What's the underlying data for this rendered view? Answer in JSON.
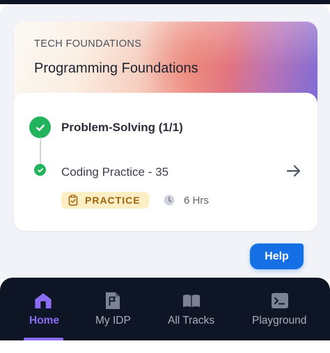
{
  "course": {
    "kicker": "TECH FOUNDATIONS",
    "title": "Programming Foundations"
  },
  "section": {
    "title": "Problem-Solving (1/1)"
  },
  "item": {
    "title": "Coding Practice - 35",
    "badge": "PRACTICE",
    "duration": "6 Hrs"
  },
  "help": {
    "label": "Help"
  },
  "nav": {
    "items": [
      {
        "label": "Home",
        "icon": "home-icon",
        "active": true
      },
      {
        "label": "My IDP",
        "icon": "flag-document-icon",
        "active": false
      },
      {
        "label": "All Tracks",
        "icon": "book-icon",
        "active": false
      },
      {
        "label": "Playground",
        "icon": "terminal-icon",
        "active": false
      }
    ]
  },
  "colors": {
    "accent": "#8b6cf5",
    "success": "#22b35d",
    "help": "#1570e6",
    "navbar": "#0e1524",
    "badge_bg": "#fcefc5",
    "badge_text": "#a0610b"
  }
}
